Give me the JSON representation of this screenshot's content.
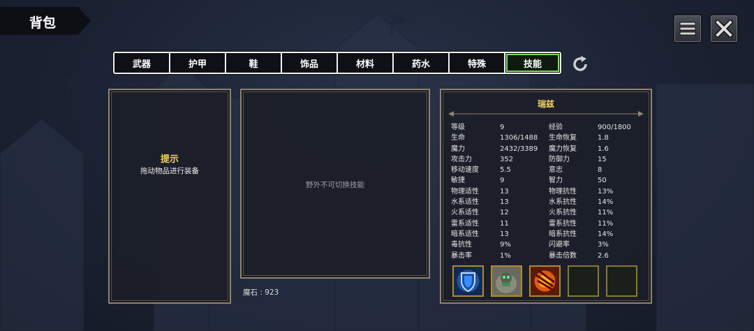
{
  "header": {
    "title": "背包"
  },
  "tabs": [
    {
      "label": "武器",
      "active": false
    },
    {
      "label": "护甲",
      "active": false
    },
    {
      "label": "鞋",
      "active": false
    },
    {
      "label": "饰品",
      "active": false
    },
    {
      "label": "材料",
      "active": false
    },
    {
      "label": "药水",
      "active": false
    },
    {
      "label": "特殊",
      "active": false
    },
    {
      "label": "技能",
      "active": true
    }
  ],
  "icons": {
    "menu": "menu-icon",
    "close": "close-icon",
    "refresh": "refresh-icon"
  },
  "left_panel": {
    "title": "提示",
    "text": "拖动物品进行装备"
  },
  "middle_panel": {
    "message": "野外不可切换技能",
    "magic_stone": "魔石 : 923"
  },
  "character": {
    "name": "瑞兹",
    "stats": [
      [
        "等级",
        "9",
        "经验",
        "900/1800"
      ],
      [
        "生命",
        "1306/1488",
        "生命恢复",
        "1.8"
      ],
      [
        "魔力",
        "2432/3389",
        "魔力恢复",
        "1.6"
      ],
      [
        "攻击力",
        "352",
        "防御力",
        "15"
      ],
      [
        "移动速度",
        "5.5",
        "意志",
        "8"
      ],
      [
        "敏捷",
        "9",
        "智力",
        "50"
      ],
      [
        "物理适性",
        "13",
        "物理抗性",
        "13%"
      ],
      [
        "水系适性",
        "13",
        "水系抗性",
        "14%"
      ],
      [
        "火系适性",
        "12",
        "火系抗性",
        "11%"
      ],
      [
        "雷系适性",
        "11",
        "雷系抗性",
        "11%"
      ],
      [
        "暗系适性",
        "13",
        "暗系抗性",
        "14%"
      ],
      [
        "毒抗性",
        "9%",
        "闪避率",
        "3%"
      ],
      [
        "暴击率",
        "1%",
        "暴击倍数",
        "2.6"
      ]
    ],
    "skills": [
      {
        "icon": "shield-skill-icon",
        "empty": false
      },
      {
        "icon": "golem-skill-icon",
        "empty": false
      },
      {
        "icon": "fire-claw-skill-icon",
        "empty": false
      },
      {
        "icon": "empty-slot",
        "empty": true
      },
      {
        "icon": "empty-slot",
        "empty": true
      }
    ]
  },
  "colors": {
    "accent": "#f4d35e",
    "active_tab": "#7ed957",
    "panel_border": "#8e8476"
  }
}
